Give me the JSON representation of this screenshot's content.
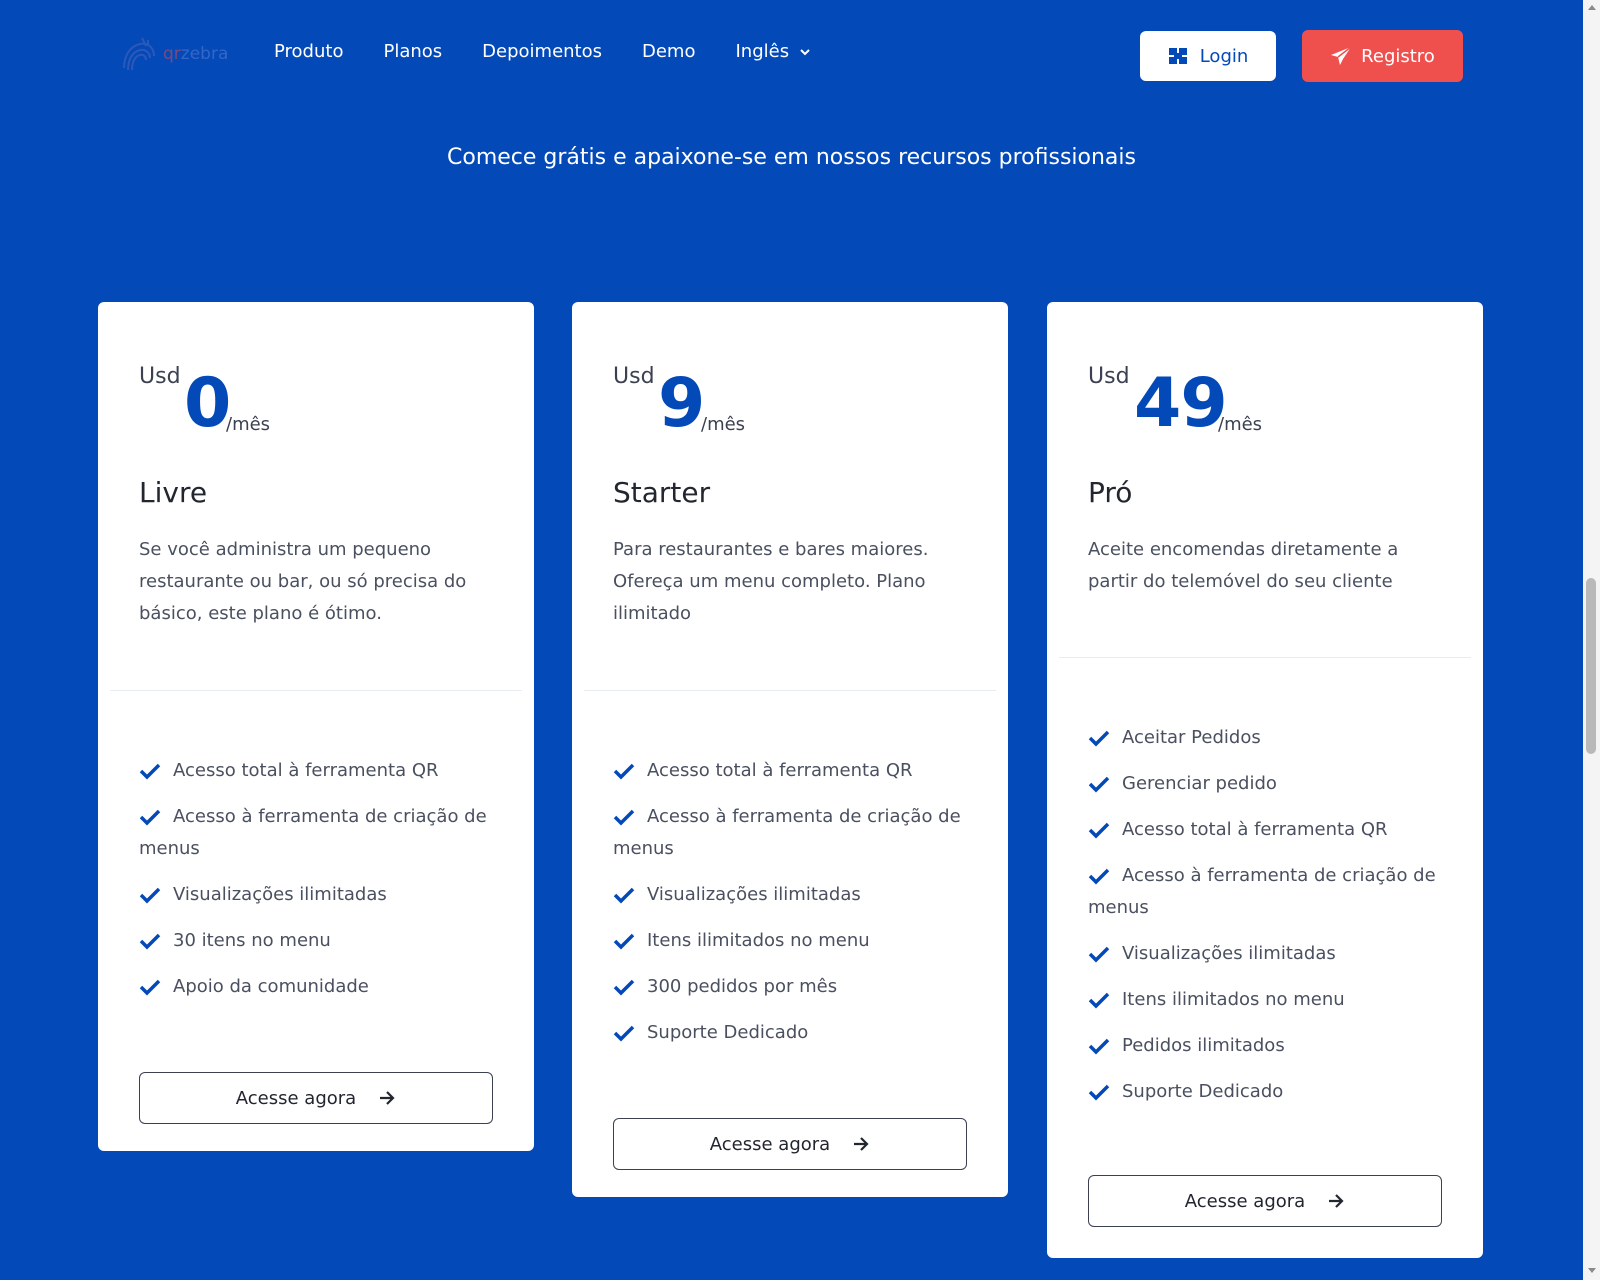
{
  "brand": {
    "logo_qr": "qr",
    "logo_zebra": "zebra",
    "colors": {
      "primary": "#0449b8",
      "register": "#f0504d",
      "white": "#ffffff"
    }
  },
  "nav": {
    "items": [
      {
        "label": "Produto"
      },
      {
        "label": "Planos"
      },
      {
        "label": "Depoimentos"
      },
      {
        "label": "Demo"
      },
      {
        "label": "Inglês",
        "icon": "chevron-down-icon"
      }
    ],
    "login_label": "Login",
    "login_icon": "login-icon",
    "register_label": "Registro",
    "register_icon": "paper-plane-icon"
  },
  "hero": {
    "subtitle": "Comece grátis e apaixone-se em nossos recursos profissionais"
  },
  "plans": [
    {
      "currency": "Usd",
      "amount": "0",
      "period": "/mês",
      "name": "Livre",
      "description": "Se você administra um pequeno restaurante ou bar, ou só precisa do básico, este plano é ótimo.",
      "features": [
        "Acesso total à ferramenta QR",
        "Acesso à ferramenta de criação de menus",
        "Visualizações ilimitadas",
        "30 itens no menu",
        "Apoio da comunidade"
      ],
      "cta": "Acesse agora"
    },
    {
      "currency": "Usd",
      "amount": "9",
      "period": "/mês",
      "name": "Starter",
      "description": "Para restaurantes e bares maiores. Ofereça um menu completo. Plano ilimitado",
      "features": [
        "Acesso total à ferramenta QR",
        "Acesso à ferramenta de criação de menus",
        "Visualizações ilimitadas",
        "Itens ilimitados no menu",
        "300 pedidos por mês",
        "Suporte Dedicado"
      ],
      "cta": "Acesse agora"
    },
    {
      "currency": "Usd",
      "amount": "49",
      "period": "/mês",
      "name": "Pró",
      "description": "Aceite encomendas diretamente a partir do telemóvel do seu cliente",
      "features": [
        "Aceitar Pedidos",
        "Gerenciar pedido",
        "Acesso total à ferramenta QR",
        "Acesso à ferramenta de criação de menus",
        "Visualizações ilimitadas",
        "Itens ilimitados no menu",
        "Pedidos ilimitados",
        "Suporte Dedicado"
      ],
      "cta": "Acesse agora"
    }
  ]
}
